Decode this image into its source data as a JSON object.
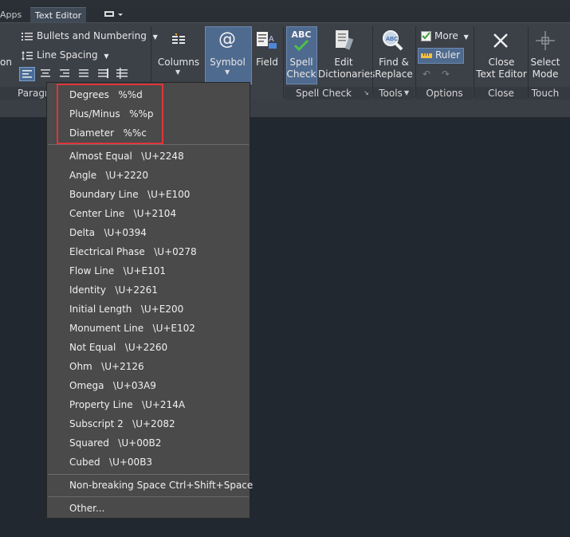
{
  "tabs": {
    "apps": "Apps",
    "text_editor": "Text Editor"
  },
  "ribbon": {
    "paragraph": {
      "partial_left": "on",
      "bullets": "Bullets and Numbering",
      "line_spacing": "Line Spacing",
      "title": "Paragr"
    },
    "columns": "Columns",
    "symbol": "Symbol",
    "field": "Field",
    "spell_check": {
      "line1": "Spell",
      "line2": "Check",
      "title": "Spell Check",
      "icon_text": "ABC"
    },
    "edit_dictionaries": {
      "line1": "Edit",
      "line2": "Dictionaries"
    },
    "find_replace": {
      "line1": "Find &",
      "line2": "Replace"
    },
    "tools_title": "Tools",
    "more": "More",
    "ruler": "Ruler",
    "options_title": "Options",
    "close": {
      "line1": "Close",
      "line2": "Text Editor",
      "title": "Close"
    },
    "select_mode": {
      "line1": "Select",
      "line2": "Mode",
      "title": "Touch"
    }
  },
  "symbol_menu": {
    "top_items": [
      "Degrees   %%d",
      "Plus/Minus   %%p",
      "Diameter   %%c"
    ],
    "items": [
      "Almost Equal   \\U+2248",
      "Angle   \\U+2220",
      "Boundary Line   \\U+E100",
      "Center Line   \\U+2104",
      "Delta   \\U+0394",
      "Electrical Phase   \\U+0278",
      "Flow Line   \\U+E101",
      "Identity   \\U+2261",
      "Initial Length   \\U+E200",
      "Monument Line   \\U+E102",
      "Not Equal   \\U+2260",
      "Ohm   \\U+2126",
      "Omega   \\U+03A9",
      "Property Line   \\U+214A",
      "Subscript 2   \\U+2082",
      "Squared   \\U+00B2",
      "Cubed   \\U+00B3"
    ],
    "nbsp": "Non-breaking Space Ctrl+Shift+Space",
    "other": "Other..."
  }
}
